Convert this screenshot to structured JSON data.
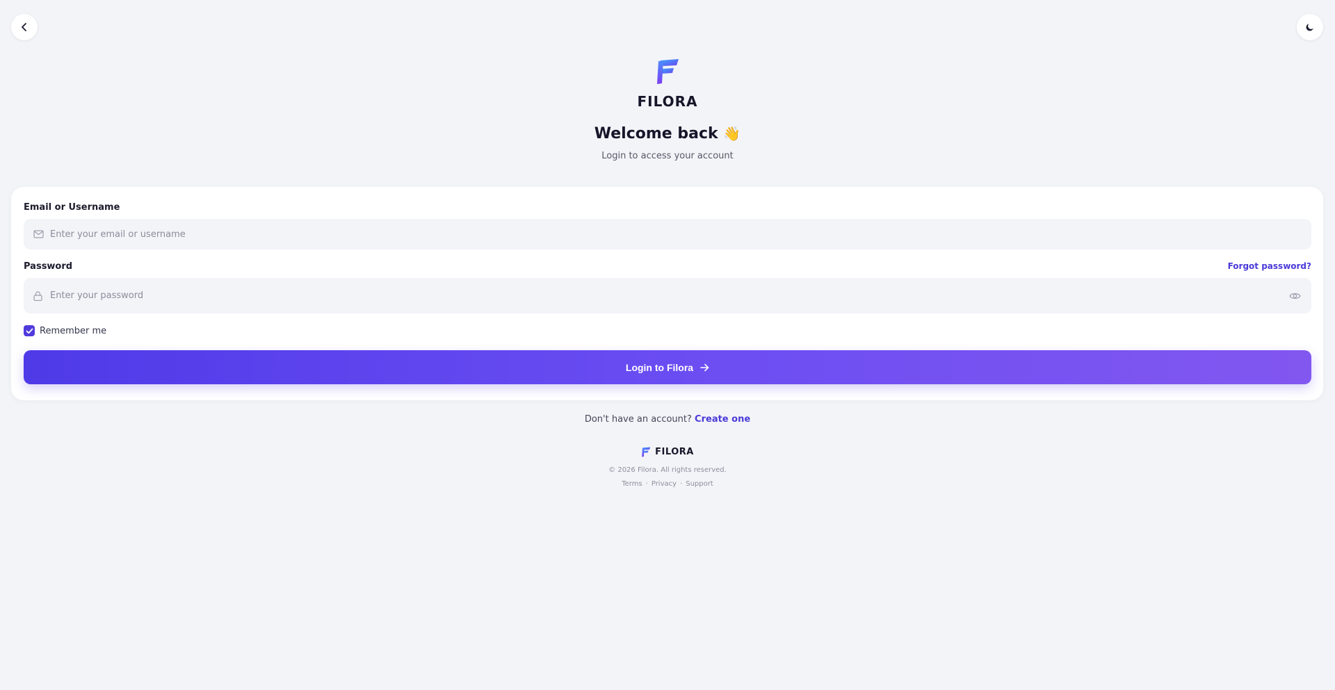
{
  "nav": {
    "back_icon": "chevron-left-icon",
    "theme_icon": "moon-icon"
  },
  "brand": {
    "name": "FILORA",
    "logo_colors": [
      "#3aa7ff",
      "#6b46f0"
    ]
  },
  "header": {
    "welcome": "Welcome back",
    "wave_emoji": "👋",
    "subtitle": "Login to access your account"
  },
  "form": {
    "email": {
      "label": "Email or Username",
      "placeholder": "Enter your email or username",
      "value": "",
      "icon": "mail-icon"
    },
    "password": {
      "label": "Password",
      "placeholder": "Enter your password",
      "value": "",
      "icon": "lock-icon",
      "toggle_icon": "eye-icon",
      "forgot_label": "Forgot password?"
    },
    "remember": {
      "label": "Remember me",
      "checked": true
    },
    "submit_label": "Login to Filora"
  },
  "signup": {
    "prompt": "Don't have an account?",
    "link": "Create one"
  },
  "footer": {
    "brand": "FILORA",
    "copyright": "© 2026 Filora. All rights reserved.",
    "links": [
      "Terms",
      "Privacy",
      "Support"
    ],
    "separator": "·"
  },
  "colors": {
    "accent": "#4f3bdc",
    "background": "#f3f4f8",
    "button_gradient": [
      "#4f3ae8",
      "#8257f0"
    ]
  }
}
